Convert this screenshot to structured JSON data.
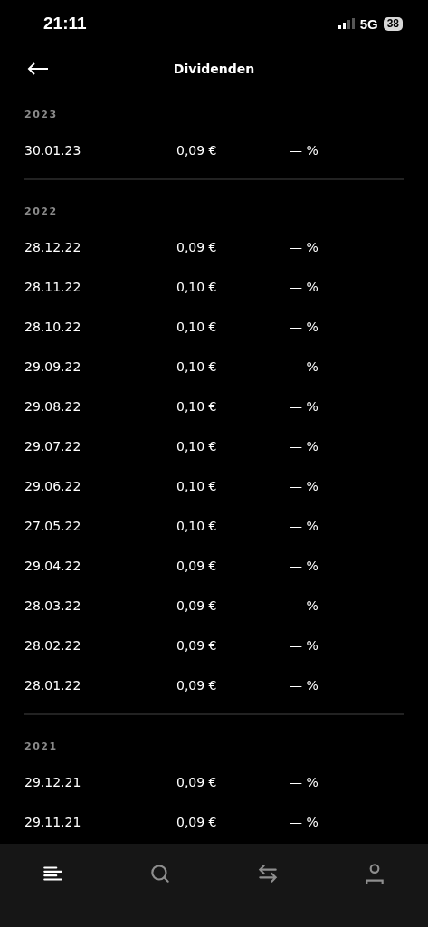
{
  "status_bar": {
    "time": "21:11",
    "network": "5G",
    "battery": "38"
  },
  "header": {
    "title": "Dividenden"
  },
  "sections": [
    {
      "year": "2023",
      "rows": [
        {
          "date": "30.01.23",
          "amount": "0,09 €",
          "yield": "— %"
        }
      ]
    },
    {
      "year": "2022",
      "rows": [
        {
          "date": "28.12.22",
          "amount": "0,09 €",
          "yield": "— %"
        },
        {
          "date": "28.11.22",
          "amount": "0,10 €",
          "yield": "— %"
        },
        {
          "date": "28.10.22",
          "amount": "0,10 €",
          "yield": "— %"
        },
        {
          "date": "29.09.22",
          "amount": "0,10 €",
          "yield": "— %"
        },
        {
          "date": "29.08.22",
          "amount": "0,10 €",
          "yield": "— %"
        },
        {
          "date": "29.07.22",
          "amount": "0,10 €",
          "yield": "— %"
        },
        {
          "date": "29.06.22",
          "amount": "0,10 €",
          "yield": "— %"
        },
        {
          "date": "27.05.22",
          "amount": "0,10 €",
          "yield": "— %"
        },
        {
          "date": "29.04.22",
          "amount": "0,09 €",
          "yield": "— %"
        },
        {
          "date": "28.03.22",
          "amount": "0,09 €",
          "yield": "— %"
        },
        {
          "date": "28.02.22",
          "amount": "0,09 €",
          "yield": "— %"
        },
        {
          "date": "28.01.22",
          "amount": "0,09 €",
          "yield": "— %"
        }
      ]
    },
    {
      "year": "2021",
      "rows": [
        {
          "date": "29.12.21",
          "amount": "0,09 €",
          "yield": "— %"
        },
        {
          "date": "29.11.21",
          "amount": "0,09 €",
          "yield": "— %"
        }
      ]
    }
  ],
  "tab_bar": [
    {
      "kind": "home",
      "selected": true
    },
    {
      "kind": "search",
      "selected": false
    },
    {
      "kind": "transfer",
      "selected": false
    },
    {
      "kind": "profile",
      "selected": false
    }
  ]
}
